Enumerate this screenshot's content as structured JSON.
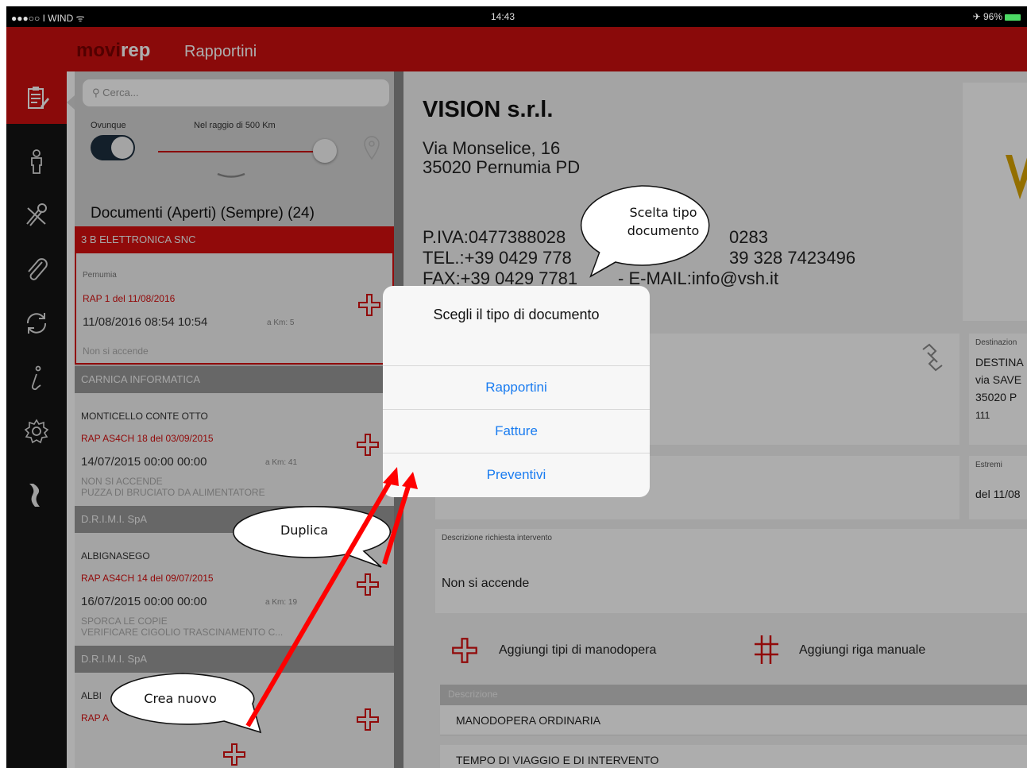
{
  "status_bar": {
    "carrier": "●●●○○ I WIND ᯤ",
    "time": "14:43",
    "battery": "✈ 96%"
  },
  "header": {
    "logo_movi": "movi",
    "logo_rep": "rep",
    "title": "Rapportini"
  },
  "sidebar": {
    "items": [
      {
        "icon": "clipboard-icon",
        "active": true
      },
      {
        "icon": "person-icon",
        "active": false
      },
      {
        "icon": "tools-icon",
        "active": false
      },
      {
        "icon": "paperclip-icon",
        "active": false
      },
      {
        "icon": "sync-icon",
        "active": false
      },
      {
        "icon": "info-icon",
        "active": false
      },
      {
        "icon": "gear-icon",
        "active": false
      },
      {
        "icon": "bracket-icon",
        "active": false
      }
    ]
  },
  "list": {
    "search_placeholder": "Cerca...",
    "filter_anywhere": "Ovunque",
    "filter_radius": "Nel raggio di 500 Km",
    "title": "Documenti (Aperti) (Sempre) (24)",
    "groups": [
      {
        "header": "3 B ELETTRONICA SNC",
        "location": "Pernumia",
        "doc": "RAP 1 del 11/08/2016",
        "datetime": "11/08/2016   08:54   10:54",
        "km": "a Km: 5",
        "desc1": "Non si accende",
        "desc2": ""
      },
      {
        "header": "CARNICA  INFORMATICA",
        "location": "MONTICELLO CONTE OTTO",
        "doc": "RAP AS4CH 18 del 03/09/2015",
        "datetime": "14/07/2015   00:00   00:00",
        "km": "a Km: 41",
        "desc1": "NON SI ACCENDE",
        "desc2": "PUZZA DI BRUCIATO DA ALIMENTATORE"
      },
      {
        "header": "D.R.I.M.I. SpA",
        "location": "ALBIGNASEGO",
        "doc": "RAP AS4CH 14 del 09/07/2015",
        "datetime": "16/07/2015   00:00   00:00",
        "km": "a Km: 19",
        "desc1": "SPORCA LE COPIE",
        "desc2": "VERIFICARE CIGOLIO TRASCINAMENTO C..."
      },
      {
        "header": "D.R.I.M.I. SpA",
        "location": "ALBI",
        "doc": "RAP A",
        "datetime": "",
        "km": "",
        "desc1": "",
        "desc2": ""
      }
    ]
  },
  "detail": {
    "company": "VISION s.r.l.",
    "address1": "Via Monselice, 16",
    "address2": "35020 Pernumia PD",
    "piva": "P.IVA:0477388028",
    "piva_tail": "0283",
    "tel": "TEL.:+39 0429 778",
    "tel_tail": "39 328 7423496",
    "fax": "FAX:+39 0429 7781",
    "fax_tail": "- E-MAIL:info@vsh.it",
    "dest_label": "Destinazion",
    "dest_name": "DESTINA",
    "dest_street": "via SAVE",
    "dest_city": "35020  P",
    "dest_num": "111",
    "estremi_label": "Estremi",
    "estremi_value": "del 11/08",
    "desc_label": "Descrizione richiesta intervento",
    "desc_value": "Non si accende",
    "add_labor": "Aggiungi tipi di manodopera",
    "add_manual": "Aggiungi riga manuale",
    "table_header": "Descrizione",
    "rows": [
      "MANODOPERA ORDINARIA",
      "TEMPO DI VIAGGIO E DI INTERVENTO"
    ]
  },
  "dialog": {
    "title": "Scegli il tipo di documento",
    "options": [
      "Rapportini",
      "Fatture",
      "Preventivi"
    ]
  },
  "callouts": {
    "type_line1": "Scelta tipo",
    "type_line2": "documento",
    "duplicate": "Duplica",
    "create": "Crea nuovo"
  },
  "colors": {
    "brand_red": "#cc1010",
    "link_blue": "#1a7cf0",
    "annotation_red": "#ff0000"
  }
}
